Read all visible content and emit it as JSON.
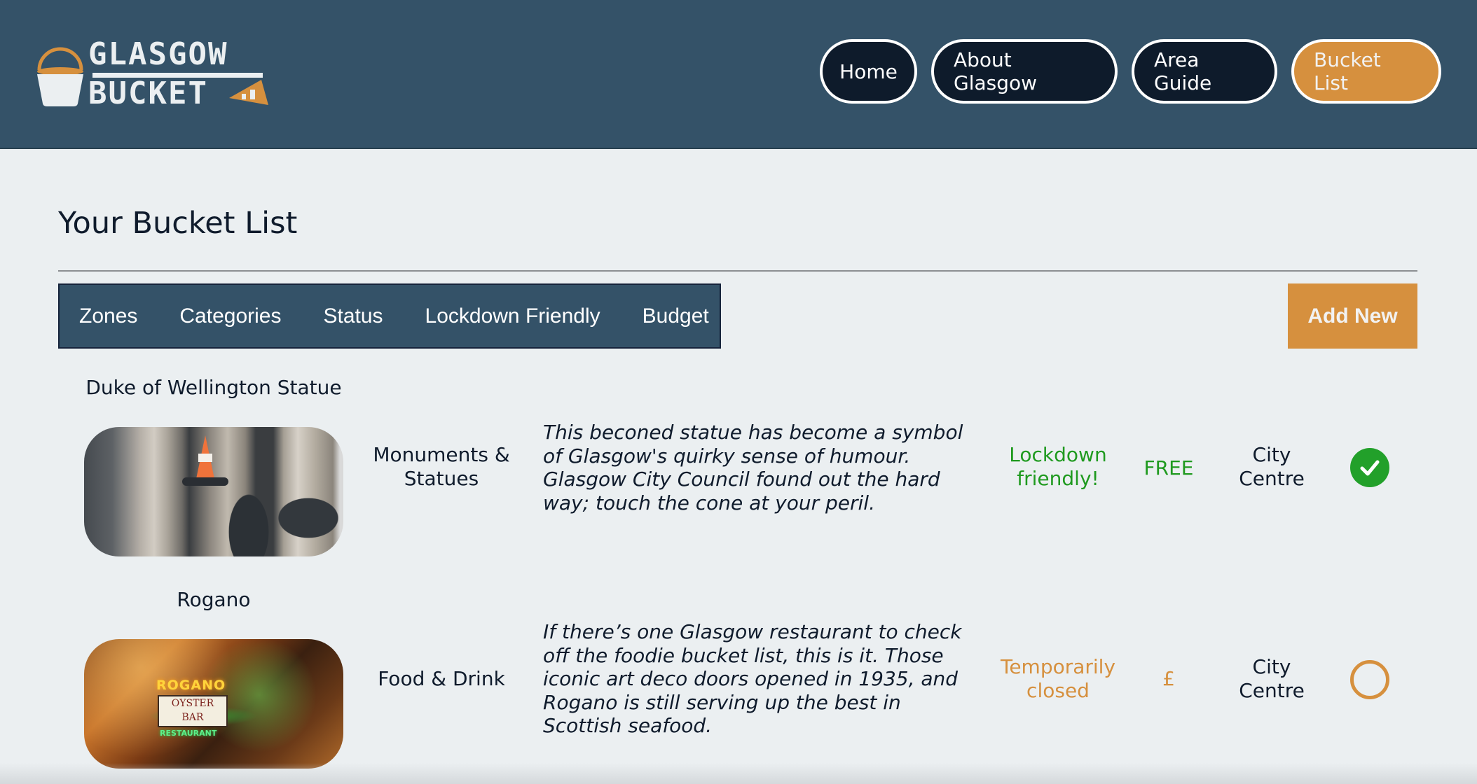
{
  "header": {
    "logo": {
      "line1": "GLASGOW",
      "line2": "BUCKET"
    },
    "nav": [
      {
        "label": "Home",
        "active": false
      },
      {
        "label": "About Glasgow",
        "active": false
      },
      {
        "label": "Area Guide",
        "active": false
      },
      {
        "label": "Bucket List",
        "active": true
      }
    ]
  },
  "main": {
    "title": "Your Bucket List",
    "filters": [
      "Zones",
      "Categories",
      "Status",
      "Lockdown Friendly",
      "Budget"
    ],
    "add_new_label": "Add New",
    "items": [
      {
        "name": "Duke of Wellington Statue",
        "image": "duke-of-wellington-statue-photo",
        "category": "Monuments & Statues",
        "description": "This beconed statue has become a symbol of Glasgow's quirky sense of humour. Glasgow City Council found out the hard way; touch the cone at your peril.",
        "status": "Lockdown friendly!",
        "status_color": "#1f9a1f",
        "budget": "FREE",
        "budget_color": "#1f9a1f",
        "zone": "City Centre",
        "completed": true,
        "completed_icon": "check-circle-icon"
      },
      {
        "name": "Rogano",
        "image": "rogano-restaurant-photo",
        "image_sign_text": {
          "name": "ROGANO",
          "oyster": "OYSTER",
          "bar": "BAR",
          "restaurant": "RESTAURANT"
        },
        "category": "Food & Drink",
        "description": "If there’s one Glasgow restaurant to check off the foodie bucket list, this is it. Those iconic art deco doors opened in 1935, and Rogano is still serving up the best in Scottish seafood.",
        "status": "Temporarily closed",
        "status_color": "#d6903e",
        "budget": "£",
        "budget_color": "#d6903e",
        "zone": "City Centre",
        "completed": false,
        "completed_icon": "empty-circle-icon"
      }
    ]
  },
  "colors": {
    "header_bg": "#345268",
    "accent": "#d6903e",
    "nav_button_bg": "#0e1b2b",
    "page_bg": "#ebeff1",
    "success": "#22a02a"
  }
}
